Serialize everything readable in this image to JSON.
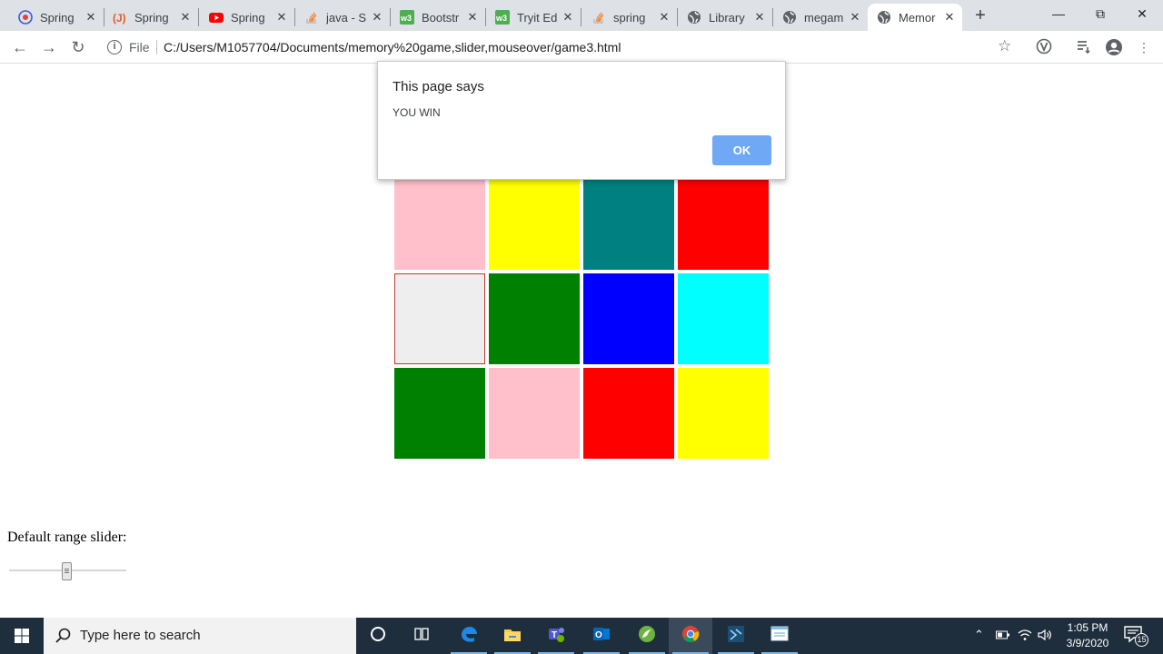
{
  "browser": {
    "tabs": [
      {
        "title": "Spring",
        "favicon": "spring-logo-icon"
      },
      {
        "title": "Spring",
        "favicon": "javatpoint-icon"
      },
      {
        "title": "Spring",
        "favicon": "youtube-icon"
      },
      {
        "title": "java - Sp",
        "favicon": "stackoverflow-icon"
      },
      {
        "title": "Bootstr",
        "favicon": "w3schools-icon"
      },
      {
        "title": "Tryit Ed",
        "favicon": "w3schools-icon"
      },
      {
        "title": "spring",
        "favicon": "stackoverflow-icon"
      },
      {
        "title": "Library",
        "favicon": "globe-icon"
      },
      {
        "title": "megam",
        "favicon": "globe-icon"
      },
      {
        "title": "Memor",
        "favicon": "globe-icon"
      }
    ],
    "active_tab_index": 9,
    "new_tab_label": "+",
    "address": {
      "scheme_label": "File",
      "url": "C:/Users/M1057704/Documents/memory%20game,slider,mouseover/game3.html"
    }
  },
  "page": {
    "grid": [
      [
        "#008080",
        "#00ffff",
        "#0000ff",
        "#ffa500"
      ],
      [
        "#ffc0cb",
        "#ffff00",
        "#008080",
        "#ff0000"
      ],
      [
        "#eeeeee",
        "#008000",
        "#0000ff",
        "#00ffff"
      ],
      [
        "#008000",
        "#ffc0cb",
        "#ff0000",
        "#ffff00"
      ]
    ],
    "selected_cell": [
      2,
      0
    ],
    "selected_border_color": "#c0392b",
    "slider": {
      "label": "Default range slider:",
      "value_fraction": 0.5
    }
  },
  "dialog": {
    "title": "This page says",
    "message": "YOU WIN",
    "ok_label": "OK"
  },
  "taskbar": {
    "search_placeholder": "Type here to search",
    "apps": [
      "cortana-icon",
      "task-view-icon",
      "edge-icon",
      "file-explorer-icon",
      "teams-icon",
      "outlook-icon",
      "spring-tool-suite-icon",
      "chrome-icon",
      "visual-studio-icon",
      "notepad-icon"
    ],
    "time": "1:05 PM",
    "date": "3/9/2020",
    "notification_count": "15"
  }
}
